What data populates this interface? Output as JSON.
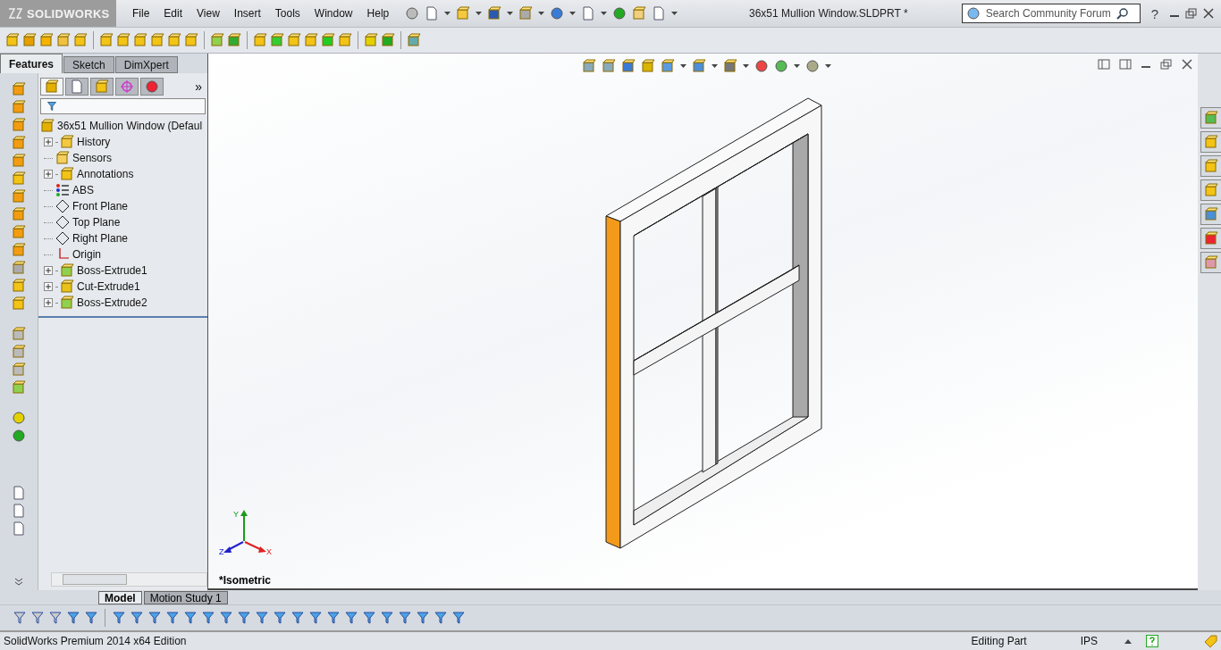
{
  "app": {
    "logo": "SOLIDWORKS",
    "menu": [
      "File",
      "Edit",
      "View",
      "Insert",
      "Tools",
      "Window",
      "Help"
    ],
    "document_title": "36x51 Mullion Window.SLDPRT *",
    "search": {
      "placeholder": "Search Community Forum"
    },
    "help": "?"
  },
  "manager_tabs": [
    {
      "label": "Features",
      "selected": true
    },
    {
      "label": "Sketch",
      "selected": false
    },
    {
      "label": "DimXpert",
      "selected": false
    }
  ],
  "feature_tree": {
    "more": "»",
    "root": "36x51 Mullion Window  (Defaul",
    "items": [
      {
        "label": "History",
        "kind": "history",
        "expandable": true
      },
      {
        "label": "Sensors",
        "kind": "sensor",
        "expandable": false
      },
      {
        "label": "Annotations",
        "kind": "annotations",
        "expandable": true
      },
      {
        "label": "ABS",
        "kind": "material",
        "expandable": false
      },
      {
        "label": "Front Plane",
        "kind": "plane",
        "expandable": false
      },
      {
        "label": "Top Plane",
        "kind": "plane",
        "expandable": false
      },
      {
        "label": "Right Plane",
        "kind": "plane",
        "expandable": false
      },
      {
        "label": "Origin",
        "kind": "origin",
        "expandable": false
      },
      {
        "label": "Boss-Extrude1",
        "kind": "extrude",
        "expandable": true
      },
      {
        "label": "Cut-Extrude1",
        "kind": "cut",
        "expandable": true
      },
      {
        "label": "Boss-Extrude2",
        "kind": "extrude",
        "expandable": true
      }
    ]
  },
  "viewport": {
    "view_name": "*Isometric",
    "triad": {
      "x": "X",
      "y": "Y",
      "z": "Z"
    }
  },
  "bottom_tabs": [
    {
      "label": "Model",
      "selected": true
    },
    {
      "label": "Motion Study 1",
      "selected": false
    }
  ],
  "status_bar": {
    "edition": "SolidWorks Premium 2014 x64 Edition",
    "mode": "Editing Part",
    "units": "IPS"
  }
}
